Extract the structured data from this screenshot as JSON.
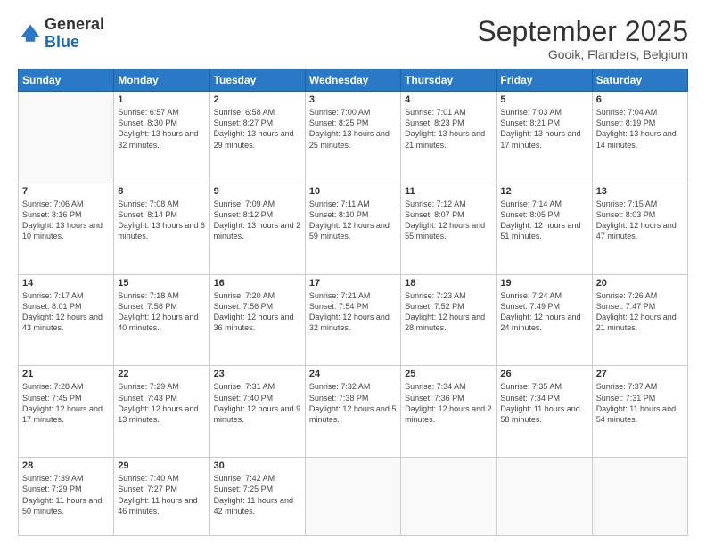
{
  "logo": {
    "general": "General",
    "blue": "Blue"
  },
  "header": {
    "month": "September 2025",
    "location": "Gooik, Flanders, Belgium"
  },
  "weekdays": [
    "Sunday",
    "Monday",
    "Tuesday",
    "Wednesday",
    "Thursday",
    "Friday",
    "Saturday"
  ],
  "weeks": [
    [
      {
        "day": "",
        "sunrise": "",
        "sunset": "",
        "daylight": ""
      },
      {
        "day": "1",
        "sunrise": "Sunrise: 6:57 AM",
        "sunset": "Sunset: 8:30 PM",
        "daylight": "Daylight: 13 hours and 32 minutes."
      },
      {
        "day": "2",
        "sunrise": "Sunrise: 6:58 AM",
        "sunset": "Sunset: 8:27 PM",
        "daylight": "Daylight: 13 hours and 29 minutes."
      },
      {
        "day": "3",
        "sunrise": "Sunrise: 7:00 AM",
        "sunset": "Sunset: 8:25 PM",
        "daylight": "Daylight: 13 hours and 25 minutes."
      },
      {
        "day": "4",
        "sunrise": "Sunrise: 7:01 AM",
        "sunset": "Sunset: 8:23 PM",
        "daylight": "Daylight: 13 hours and 21 minutes."
      },
      {
        "day": "5",
        "sunrise": "Sunrise: 7:03 AM",
        "sunset": "Sunset: 8:21 PM",
        "daylight": "Daylight: 13 hours and 17 minutes."
      },
      {
        "day": "6",
        "sunrise": "Sunrise: 7:04 AM",
        "sunset": "Sunset: 8:19 PM",
        "daylight": "Daylight: 13 hours and 14 minutes."
      }
    ],
    [
      {
        "day": "7",
        "sunrise": "Sunrise: 7:06 AM",
        "sunset": "Sunset: 8:16 PM",
        "daylight": "Daylight: 13 hours and 10 minutes."
      },
      {
        "day": "8",
        "sunrise": "Sunrise: 7:08 AM",
        "sunset": "Sunset: 8:14 PM",
        "daylight": "Daylight: 13 hours and 6 minutes."
      },
      {
        "day": "9",
        "sunrise": "Sunrise: 7:09 AM",
        "sunset": "Sunset: 8:12 PM",
        "daylight": "Daylight: 13 hours and 2 minutes."
      },
      {
        "day": "10",
        "sunrise": "Sunrise: 7:11 AM",
        "sunset": "Sunset: 8:10 PM",
        "daylight": "Daylight: 12 hours and 59 minutes."
      },
      {
        "day": "11",
        "sunrise": "Sunrise: 7:12 AM",
        "sunset": "Sunset: 8:07 PM",
        "daylight": "Daylight: 12 hours and 55 minutes."
      },
      {
        "day": "12",
        "sunrise": "Sunrise: 7:14 AM",
        "sunset": "Sunset: 8:05 PM",
        "daylight": "Daylight: 12 hours and 51 minutes."
      },
      {
        "day": "13",
        "sunrise": "Sunrise: 7:15 AM",
        "sunset": "Sunset: 8:03 PM",
        "daylight": "Daylight: 12 hours and 47 minutes."
      }
    ],
    [
      {
        "day": "14",
        "sunrise": "Sunrise: 7:17 AM",
        "sunset": "Sunset: 8:01 PM",
        "daylight": "Daylight: 12 hours and 43 minutes."
      },
      {
        "day": "15",
        "sunrise": "Sunrise: 7:18 AM",
        "sunset": "Sunset: 7:58 PM",
        "daylight": "Daylight: 12 hours and 40 minutes."
      },
      {
        "day": "16",
        "sunrise": "Sunrise: 7:20 AM",
        "sunset": "Sunset: 7:56 PM",
        "daylight": "Daylight: 12 hours and 36 minutes."
      },
      {
        "day": "17",
        "sunrise": "Sunrise: 7:21 AM",
        "sunset": "Sunset: 7:54 PM",
        "daylight": "Daylight: 12 hours and 32 minutes."
      },
      {
        "day": "18",
        "sunrise": "Sunrise: 7:23 AM",
        "sunset": "Sunset: 7:52 PM",
        "daylight": "Daylight: 12 hours and 28 minutes."
      },
      {
        "day": "19",
        "sunrise": "Sunrise: 7:24 AM",
        "sunset": "Sunset: 7:49 PM",
        "daylight": "Daylight: 12 hours and 24 minutes."
      },
      {
        "day": "20",
        "sunrise": "Sunrise: 7:26 AM",
        "sunset": "Sunset: 7:47 PM",
        "daylight": "Daylight: 12 hours and 21 minutes."
      }
    ],
    [
      {
        "day": "21",
        "sunrise": "Sunrise: 7:28 AM",
        "sunset": "Sunset: 7:45 PM",
        "daylight": "Daylight: 12 hours and 17 minutes."
      },
      {
        "day": "22",
        "sunrise": "Sunrise: 7:29 AM",
        "sunset": "Sunset: 7:43 PM",
        "daylight": "Daylight: 12 hours and 13 minutes."
      },
      {
        "day": "23",
        "sunrise": "Sunrise: 7:31 AM",
        "sunset": "Sunset: 7:40 PM",
        "daylight": "Daylight: 12 hours and 9 minutes."
      },
      {
        "day": "24",
        "sunrise": "Sunrise: 7:32 AM",
        "sunset": "Sunset: 7:38 PM",
        "daylight": "Daylight: 12 hours and 5 minutes."
      },
      {
        "day": "25",
        "sunrise": "Sunrise: 7:34 AM",
        "sunset": "Sunset: 7:36 PM",
        "daylight": "Daylight: 12 hours and 2 minutes."
      },
      {
        "day": "26",
        "sunrise": "Sunrise: 7:35 AM",
        "sunset": "Sunset: 7:34 PM",
        "daylight": "Daylight: 11 hours and 58 minutes."
      },
      {
        "day": "27",
        "sunrise": "Sunrise: 7:37 AM",
        "sunset": "Sunset: 7:31 PM",
        "daylight": "Daylight: 11 hours and 54 minutes."
      }
    ],
    [
      {
        "day": "28",
        "sunrise": "Sunrise: 7:39 AM",
        "sunset": "Sunset: 7:29 PM",
        "daylight": "Daylight: 11 hours and 50 minutes."
      },
      {
        "day": "29",
        "sunrise": "Sunrise: 7:40 AM",
        "sunset": "Sunset: 7:27 PM",
        "daylight": "Daylight: 11 hours and 46 minutes."
      },
      {
        "day": "30",
        "sunrise": "Sunrise: 7:42 AM",
        "sunset": "Sunset: 7:25 PM",
        "daylight": "Daylight: 11 hours and 42 minutes."
      },
      {
        "day": "",
        "sunrise": "",
        "sunset": "",
        "daylight": ""
      },
      {
        "day": "",
        "sunrise": "",
        "sunset": "",
        "daylight": ""
      },
      {
        "day": "",
        "sunrise": "",
        "sunset": "",
        "daylight": ""
      },
      {
        "day": "",
        "sunrise": "",
        "sunset": "",
        "daylight": ""
      }
    ]
  ]
}
